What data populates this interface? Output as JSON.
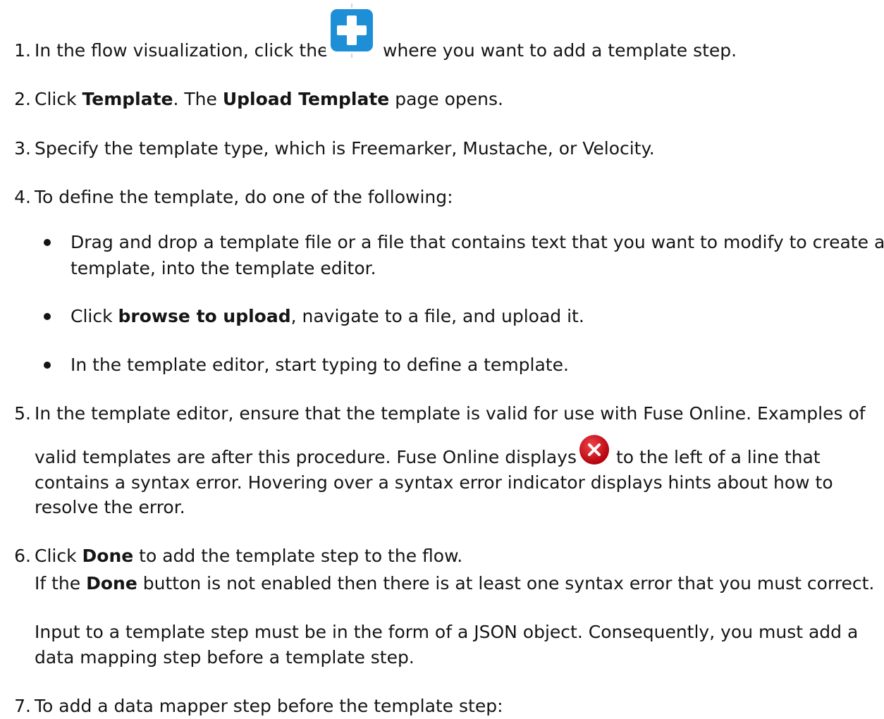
{
  "steps": [
    {
      "num": "1.",
      "before": "In the flow visualization, click the",
      "after": "where you want to add a template step."
    },
    {
      "num": "2.",
      "t1": "Click ",
      "b1": "Template",
      "t2": ". The ",
      "b2": "Upload Template",
      "t3": " page opens."
    },
    {
      "num": "3.",
      "text": "Specify the template type, which is Freemarker, Mustache, or Velocity."
    },
    {
      "num": "4.",
      "text": "To define the template, do one of the following:"
    },
    {
      "num": "5.",
      "line1": "In the template editor, ensure that the template is valid for use with Fuse Online. Examples of",
      "line2a": "valid templates are after this procedure. Fuse Online displays",
      "line2b": "to the left of a line that",
      "line3": "contains a syntax error. Hovering over a syntax error indicator displays hints about how to",
      "line4": "resolve the error."
    },
    {
      "num": "6.",
      "t1": "Click ",
      "b1": "Done",
      "t2": " to add the template step to the flow.",
      "l2a": "If the ",
      "l2b": "Done",
      "l2c": " button is not enabled then there is at least one syntax error that you must correct.",
      "note1": "Input to a template step must be in the form of a JSON object. Consequently, you must add a",
      "note2": "data mapping step before a template step."
    },
    {
      "num": "7.",
      "text": "To add a data mapper step before the template step:"
    }
  ],
  "bullets": [
    {
      "line1": "Drag and drop a template file or a file that contains text that you want to modify to create a",
      "line2": "template, into the template editor."
    },
    {
      "t1": "Click ",
      "b1": "browse to upload",
      "t2": ", navigate to a file, and upload it."
    },
    {
      "text": "In the template editor, start typing to define a template."
    }
  ],
  "icons": {
    "add_step": "plus-icon",
    "syntax_error": "error-x-icon",
    "add_color": "#1e8fd6",
    "error_color": "#c9190b"
  }
}
